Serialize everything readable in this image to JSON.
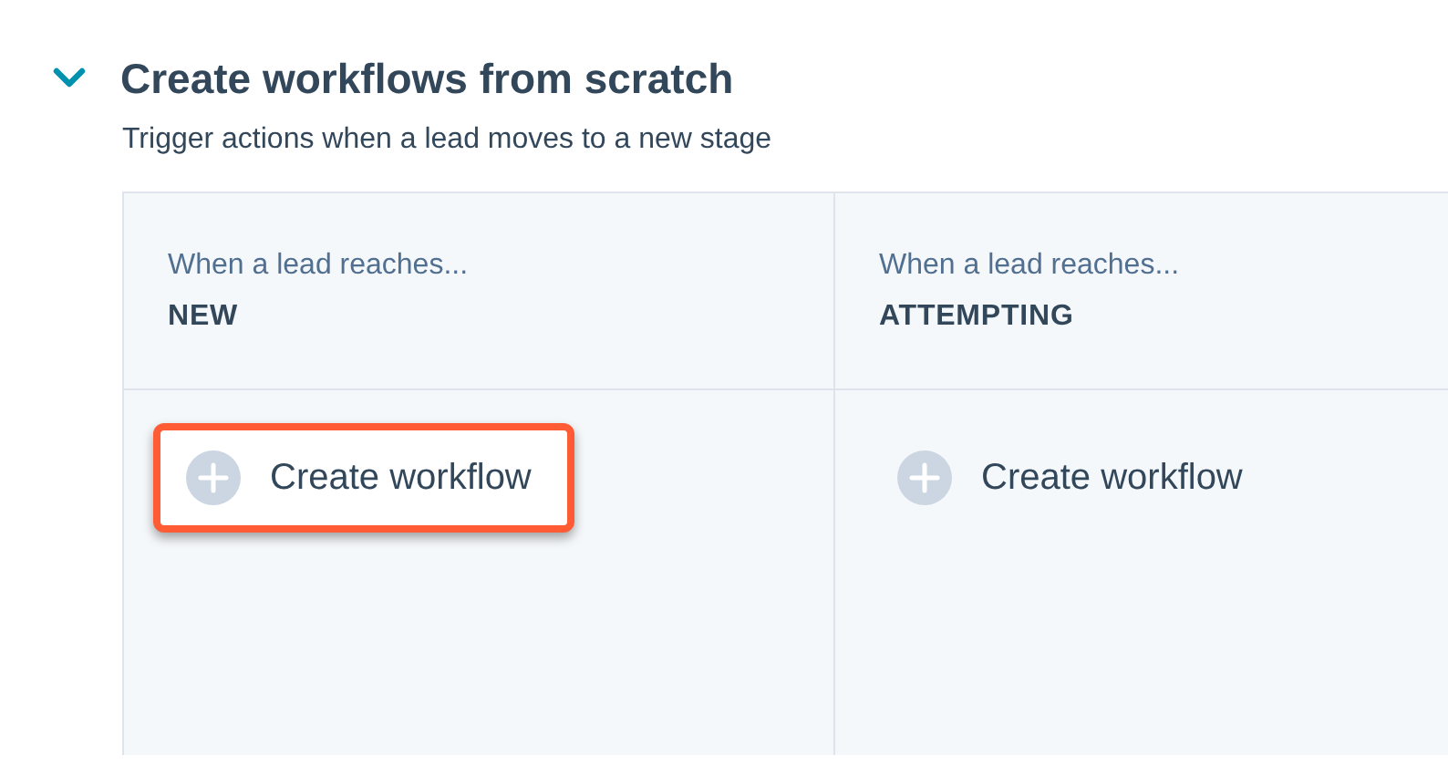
{
  "section": {
    "title": "Create workflows from scratch",
    "subtitle": "Trigger actions when a lead moves to a new stage",
    "expanded": true
  },
  "stages": [
    {
      "caption": "When a lead reaches...",
      "stage": "NEW",
      "action": "Create workflow",
      "highlighted": true
    },
    {
      "caption": "When a lead reaches...",
      "stage": "ATTEMPTING",
      "action": "Create workflow",
      "highlighted": false
    }
  ]
}
